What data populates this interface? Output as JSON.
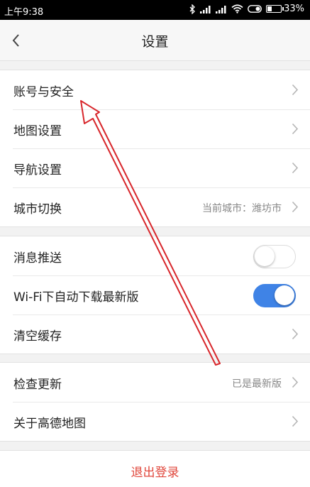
{
  "status_bar": {
    "time": "上午9:38",
    "battery": "33%",
    "battery_level": 0.33,
    "icons": [
      "bluetooth-icon",
      "signal-icon",
      "signal-icon",
      "wifi-icon",
      "toggle-icon",
      "battery-icon"
    ]
  },
  "header": {
    "back_icon": "chevron-left-icon",
    "title": "设置"
  },
  "groups": [
    {
      "items": [
        {
          "label": "账号与安全",
          "value": "",
          "control": "chevron"
        },
        {
          "label": "地图设置",
          "value": "",
          "control": "chevron"
        },
        {
          "label": "导航设置",
          "value": "",
          "control": "chevron"
        },
        {
          "label": "城市切换",
          "value": "当前城市：潍坊市",
          "control": "chevron"
        }
      ]
    },
    {
      "items": [
        {
          "label": "消息推送",
          "control": "toggle",
          "on": false
        },
        {
          "label": "Wi-Fi下自动下载最新版",
          "control": "toggle",
          "on": true
        },
        {
          "label": "清空缓存",
          "value": "",
          "control": "chevron"
        }
      ]
    },
    {
      "items": [
        {
          "label": "检查更新",
          "value": "已是最新版",
          "control": "chevron"
        },
        {
          "label": "关于高德地图",
          "value": "",
          "control": "chevron"
        }
      ]
    }
  ],
  "logout": {
    "label": "退出登录"
  },
  "colors": {
    "accent": "#3f83e6",
    "logout_text": "#e0463b",
    "annotation_arrow": "#d8262b",
    "background": "#f2f2f2"
  }
}
